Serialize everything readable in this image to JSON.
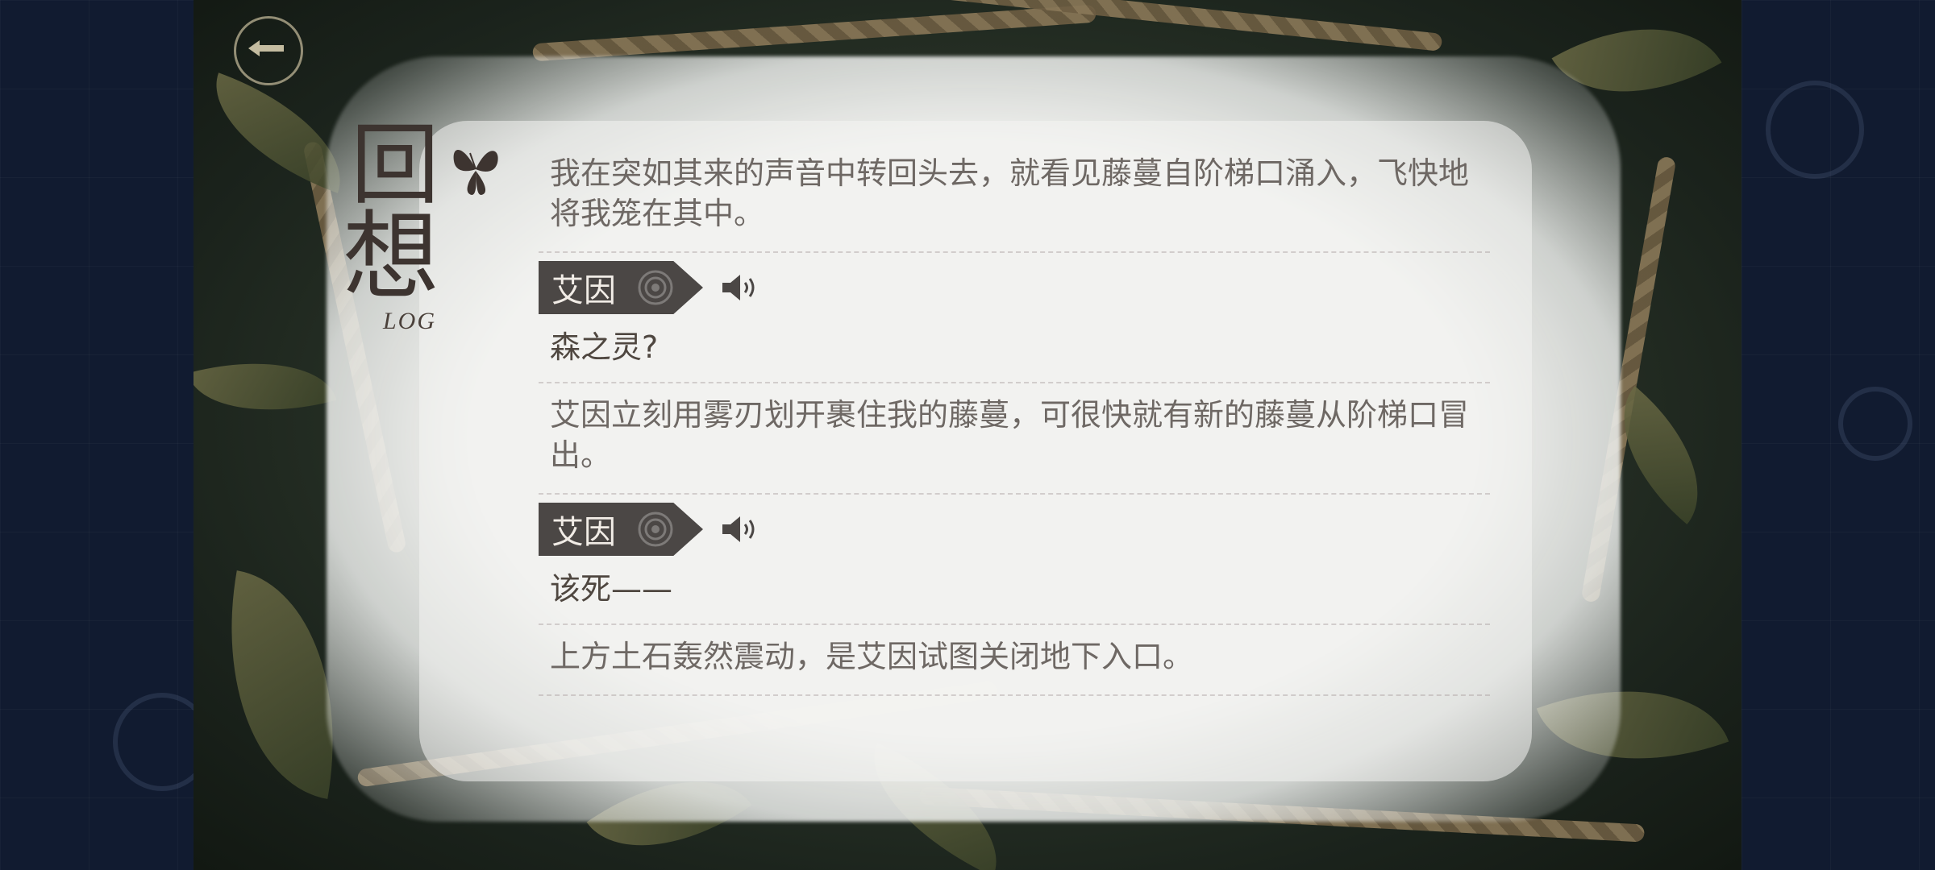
{
  "title": {
    "main_top": "回",
    "main_bottom": "想",
    "subtitle": "LOG"
  },
  "icons": {
    "back": "back-arrow-icon",
    "title_ornament": "butterfly-icon",
    "speaker_badge": "rose-icon",
    "voice": "speaker-volume-icon"
  },
  "colors": {
    "speaker_tag_bg": "#4b4745",
    "narration_text": "#6e6864",
    "dialogue_text": "#4f4740",
    "panel_bg": "#f4f4f2"
  },
  "log": [
    {
      "type": "narration",
      "text": "我在突如其来的声音中转回头去，就看见藤蔓自阶梯口涌入，飞快地将我笼在其中。"
    },
    {
      "type": "dialogue",
      "speaker": "艾因",
      "text": "森之灵?"
    },
    {
      "type": "narration",
      "text": "艾因立刻用雾刃划开裹住我的藤蔓，可很快就有新的藤蔓从阶梯口冒出。"
    },
    {
      "type": "dialogue",
      "speaker": "艾因",
      "text": "该死——"
    },
    {
      "type": "narration",
      "text": "上方土石轰然震动，是艾因试图关闭地下入口。"
    }
  ]
}
